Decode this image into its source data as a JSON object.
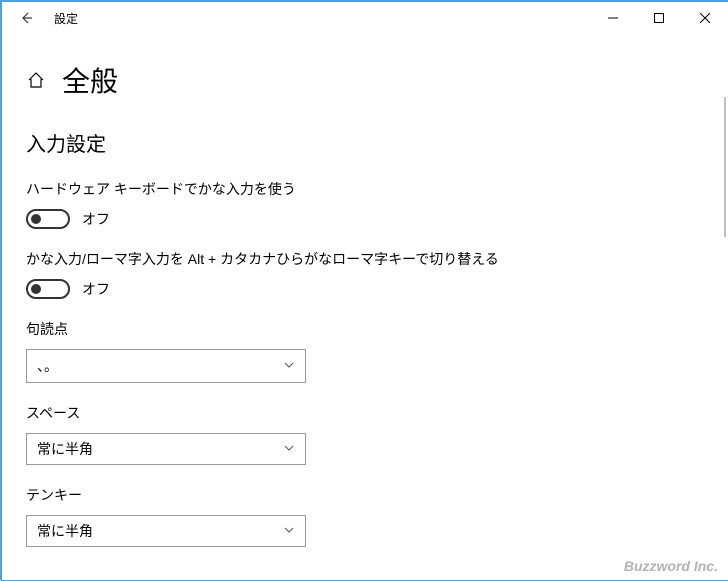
{
  "window": {
    "title": "設定"
  },
  "page": {
    "title": "全般"
  },
  "section": {
    "input_settings": "入力設定"
  },
  "settings": {
    "kana_hw": {
      "label": "ハードウェア キーボードでかな入力を使う",
      "state": "オフ"
    },
    "kana_romaji_switch": {
      "label": "かな入力/ローマ字入力を Alt + カタカナひらがなローマ字キーで切り替える",
      "state": "オフ"
    },
    "punctuation": {
      "label": "句読点",
      "value": "、。"
    },
    "space": {
      "label": "スペース",
      "value": "常に半角"
    },
    "tenkey": {
      "label": "テンキー",
      "value": "常に半角"
    }
  },
  "watermark": "Buzzword Inc."
}
